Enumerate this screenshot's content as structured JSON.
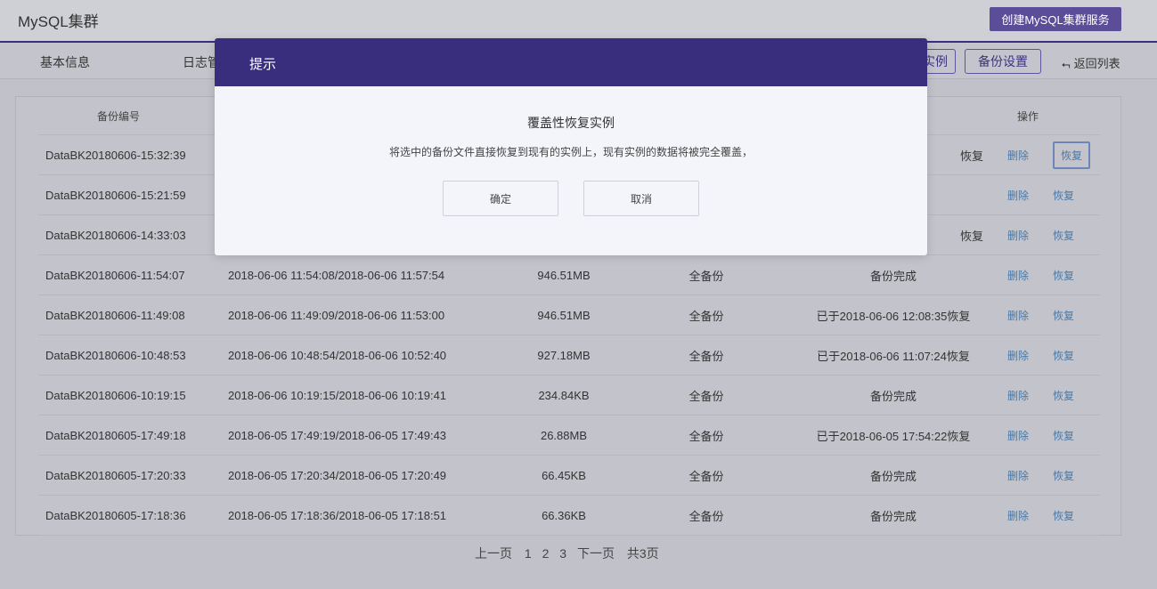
{
  "app": {
    "title": "MySQL集群",
    "create_button": "创建MySQL集群服务"
  },
  "nav": {
    "tabs": [
      "基本信息",
      "日志管"
    ],
    "button_partial": "实例",
    "backup_settings": "备份设置",
    "back": "返回列表"
  },
  "table": {
    "headers": {
      "id": "备份编号",
      "ops": "操作"
    },
    "delete_label": "删除",
    "restore_label": "恢复",
    "rows": [
      {
        "id": "DataBK20180606-15:32:39",
        "time": "",
        "size": "",
        "type": "",
        "status": "恢复"
      },
      {
        "id": "DataBK20180606-15:21:59",
        "time": "",
        "size": "",
        "type": "",
        "status": ""
      },
      {
        "id": "DataBK20180606-14:33:03",
        "time": "",
        "size": "",
        "type": "",
        "status": "恢复"
      },
      {
        "id": "DataBK20180606-11:54:07",
        "time": "2018-06-06 11:54:08/2018-06-06 11:57:54",
        "size": "946.51MB",
        "type": "全备份",
        "status": "备份完成"
      },
      {
        "id": "DataBK20180606-11:49:08",
        "time": "2018-06-06 11:49:09/2018-06-06 11:53:00",
        "size": "946.51MB",
        "type": "全备份",
        "status": "已于2018-06-06 12:08:35恢复"
      },
      {
        "id": "DataBK20180606-10:48:53",
        "time": "2018-06-06 10:48:54/2018-06-06 10:52:40",
        "size": "927.18MB",
        "type": "全备份",
        "status": "已于2018-06-06 11:07:24恢复"
      },
      {
        "id": "DataBK20180606-10:19:15",
        "time": "2018-06-06 10:19:15/2018-06-06 10:19:41",
        "size": "234.84KB",
        "type": "全备份",
        "status": "备份完成"
      },
      {
        "id": "DataBK20180605-17:49:18",
        "time": "2018-06-05 17:49:19/2018-06-05 17:49:43",
        "size": "26.88MB",
        "type": "全备份",
        "status": "已于2018-06-05 17:54:22恢复"
      },
      {
        "id": "DataBK20180605-17:20:33",
        "time": "2018-06-05 17:20:34/2018-06-05 17:20:49",
        "size": "66.45KB",
        "type": "全备份",
        "status": "备份完成"
      },
      {
        "id": "DataBK20180605-17:18:36",
        "time": "2018-06-05 17:18:36/2018-06-05 17:18:51",
        "size": "66.36KB",
        "type": "全备份",
        "status": "备份完成"
      }
    ]
  },
  "pagination": {
    "prev": "上一页",
    "pages": [
      "1",
      "2",
      "3"
    ],
    "next": "下一页",
    "total": "共3页"
  },
  "modal": {
    "title": "提示",
    "subtitle": "覆盖性恢复实例",
    "message": "将选中的备份文件直接恢复到现有的实例上，现有实例的数据将被完全覆盖，",
    "confirm": "确定",
    "cancel": "取消"
  },
  "colors": {
    "accent": "#392e7e",
    "link": "#4a78a6"
  }
}
